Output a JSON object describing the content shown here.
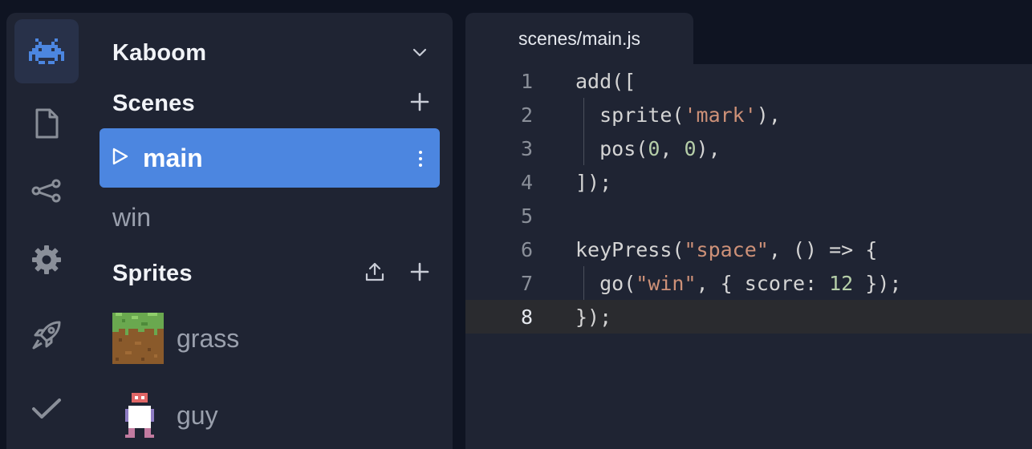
{
  "rail": {
    "items": [
      {
        "icon": "game-controller-icon",
        "active": true
      },
      {
        "icon": "file-icon",
        "active": false
      },
      {
        "icon": "share-nodes-icon",
        "active": false
      },
      {
        "icon": "gear-icon",
        "active": false
      },
      {
        "icon": "rocket-icon",
        "active": false
      },
      {
        "icon": "checkmark-icon",
        "active": false
      }
    ]
  },
  "sidebar": {
    "project_name": "Kaboom",
    "scenes_title": "Scenes",
    "scenes": [
      {
        "label": "main",
        "selected": true
      },
      {
        "label": "win",
        "selected": false
      }
    ],
    "sprites_title": "Sprites",
    "sprites": [
      {
        "label": "grass"
      },
      {
        "label": "guy"
      }
    ]
  },
  "editor": {
    "tab_label": "scenes/main.js",
    "current_line": 8,
    "lines": [
      {
        "num": "1",
        "text": "add(["
      },
      {
        "num": "2",
        "text": "  sprite('mark'),"
      },
      {
        "num": "3",
        "text": "  pos(0, 0),"
      },
      {
        "num": "4",
        "text": "]);"
      },
      {
        "num": "5",
        "text": ""
      },
      {
        "num": "6",
        "text": "keyPress(\"space\", () => {"
      },
      {
        "num": "7",
        "text": "  go(\"win\", { score: 12 });"
      },
      {
        "num": "8",
        "text": "});"
      }
    ]
  },
  "colors": {
    "accent": "#4c86e0",
    "string": "#ce9178",
    "number": "#b5cea8",
    "text": "#d4d4d4"
  }
}
